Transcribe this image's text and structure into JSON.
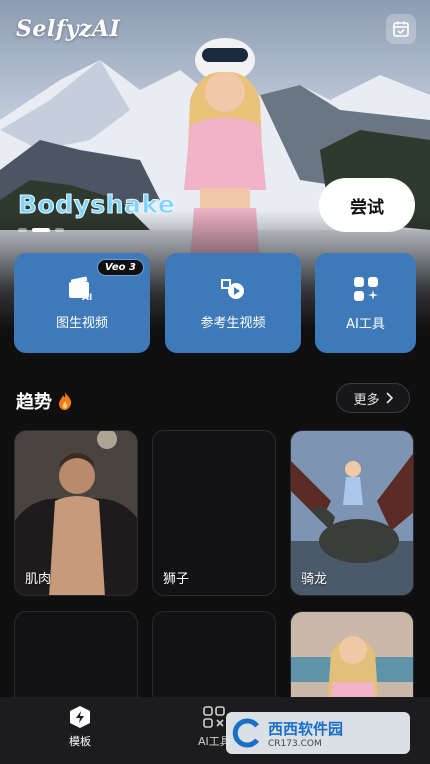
{
  "app": {
    "logo": "SelfyzAI"
  },
  "hero": {
    "title": "Bodyshake",
    "try_label": "尝试",
    "slide_count": 3,
    "active_slide": 1
  },
  "features": [
    {
      "label": "图生视频",
      "badge": "Veo 3",
      "icon": "image-to-video-icon"
    },
    {
      "label": "参考生视频",
      "icon": "reference-video-icon"
    },
    {
      "label": "AI工具",
      "icon": "ai-tools-grid-icon"
    }
  ],
  "trending": {
    "title": "趋势",
    "more_label": "更多",
    "cards": [
      {
        "caption": "肌肉"
      },
      {
        "caption": "狮子"
      },
      {
        "caption": "骑龙"
      }
    ]
  },
  "tabbar": {
    "items": [
      {
        "label": "模板",
        "active": true,
        "icon": "template-icon"
      },
      {
        "label": "AI工具",
        "active": false,
        "icon": "ai-tools-icon"
      }
    ]
  },
  "watermark": {
    "main": "西西软件园",
    "sub": "CR173.COM"
  },
  "colors": {
    "accent": "#3e79ba",
    "hero_title": "#7fd4ff",
    "background": "#0f0f10"
  }
}
